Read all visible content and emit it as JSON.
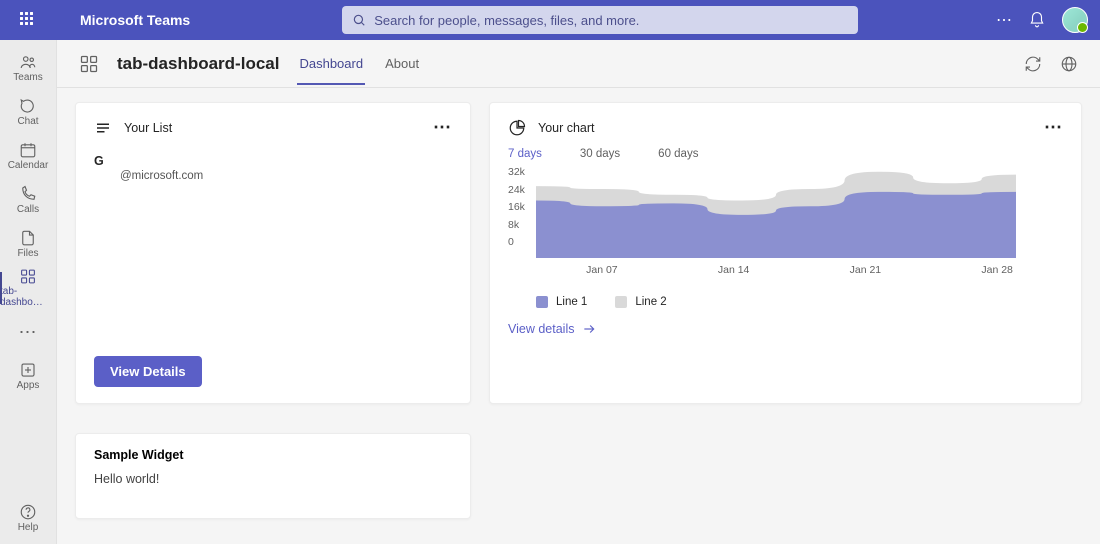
{
  "header": {
    "brand": "Microsoft Teams",
    "search_placeholder": "Search for people, messages, files, and more."
  },
  "rail": {
    "items": [
      {
        "id": "teams",
        "label": "Teams"
      },
      {
        "id": "chat",
        "label": "Chat"
      },
      {
        "id": "calendar",
        "label": "Calendar"
      },
      {
        "id": "calls",
        "label": "Calls"
      },
      {
        "id": "files",
        "label": "Files"
      },
      {
        "id": "tab-dashboard",
        "label": "tab-dashbo…"
      }
    ],
    "apps_label": "Apps",
    "help_label": "Help"
  },
  "tabbar": {
    "title": "tab-dashboard-local",
    "tabs": [
      {
        "label": "Dashboard",
        "active": true
      },
      {
        "label": "About",
        "active": false
      }
    ]
  },
  "list_card": {
    "title": "Your List",
    "row_primary": "G",
    "row_secondary": "@microsoft.com",
    "button": "View Details"
  },
  "chart_card": {
    "title": "Your chart",
    "ranges": [
      {
        "label": "7 days",
        "active": true
      },
      {
        "label": "30 days",
        "active": false
      },
      {
        "label": "60 days",
        "active": false
      }
    ],
    "link": "View details"
  },
  "chart_data": {
    "type": "area",
    "title": "Your chart",
    "xlabel": "",
    "ylabel": "",
    "ylim": [
      0,
      32000
    ],
    "y_ticks": [
      "32k",
      "24k",
      "16k",
      "8k",
      "0"
    ],
    "categories": [
      "Jan 07",
      "Jan 14",
      "Jan 21",
      "Jan 28"
    ],
    "series": [
      {
        "name": "Line 1",
        "color": "#8b90d0",
        "values": [
          20000,
          18000,
          19000,
          15000,
          18000,
          23000,
          22000,
          23000
        ]
      },
      {
        "name": "Line 2",
        "color": "#d9d9d9",
        "values": [
          25000,
          24000,
          22000,
          20000,
          24000,
          30000,
          26000,
          29000
        ]
      }
    ],
    "legend": [
      {
        "name": "Line 1",
        "color": "#8b90d0"
      },
      {
        "name": "Line 2",
        "color": "#d9d9d9"
      }
    ]
  },
  "sample_card": {
    "title": "Sample Widget",
    "body": "Hello world!"
  }
}
